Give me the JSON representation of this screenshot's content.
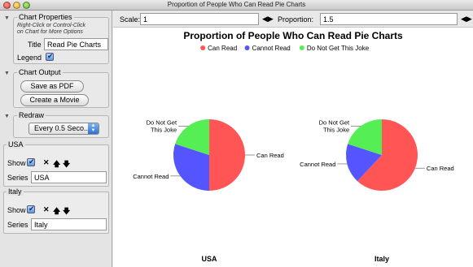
{
  "window": {
    "title": "Proportion of People Who Can Read Pie Charts"
  },
  "sidebar": {
    "chart_properties": {
      "title": "Chart Properties",
      "hint_line1": "Right-Click or Control-Click",
      "hint_line2": "on Chart for More Options",
      "title_label": "Title",
      "title_value": "Read Pie Charts",
      "legend_label": "Legend",
      "legend_checked": true
    },
    "chart_output": {
      "title": "Chart Output",
      "save_pdf": "Save as PDF",
      "create_movie": "Create a Movie"
    },
    "redraw": {
      "title": "Redraw",
      "selected": "Every 0.5 Seco..."
    },
    "series": [
      {
        "title": "USA",
        "show_label": "Show",
        "series_label": "Series",
        "series_value": "USA",
        "show_checked": true
      },
      {
        "title": "Italy",
        "show_label": "Show",
        "series_label": "Series",
        "series_value": "Italy",
        "show_checked": true
      }
    ]
  },
  "toolbar": {
    "scale_label": "Scale:",
    "scale_value": "1",
    "proportion_label": "Proportion:",
    "proportion_value": "1.5"
  },
  "chart_data": {
    "type": "pie",
    "title": "Proportion of People Who Can Read Pie Charts",
    "legend": [
      {
        "name": "Can Read",
        "color": "#ff5555"
      },
      {
        "name": "Cannot Read",
        "color": "#5555ff"
      },
      {
        "name": "Do Not Get This Joke",
        "color": "#55ee55"
      }
    ],
    "legend_placement": "top",
    "pies": [
      {
        "name": "USA",
        "labels": [
          "Can Read",
          "Cannot Read",
          "Do Not Get This Joke"
        ],
        "values": [
          0.5,
          0.3,
          0.2
        ]
      },
      {
        "name": "Italy",
        "labels": [
          "Can Read",
          "Cannot Read",
          "Do Not Get This Joke"
        ],
        "values": [
          0.62,
          0.18,
          0.2
        ]
      }
    ]
  }
}
